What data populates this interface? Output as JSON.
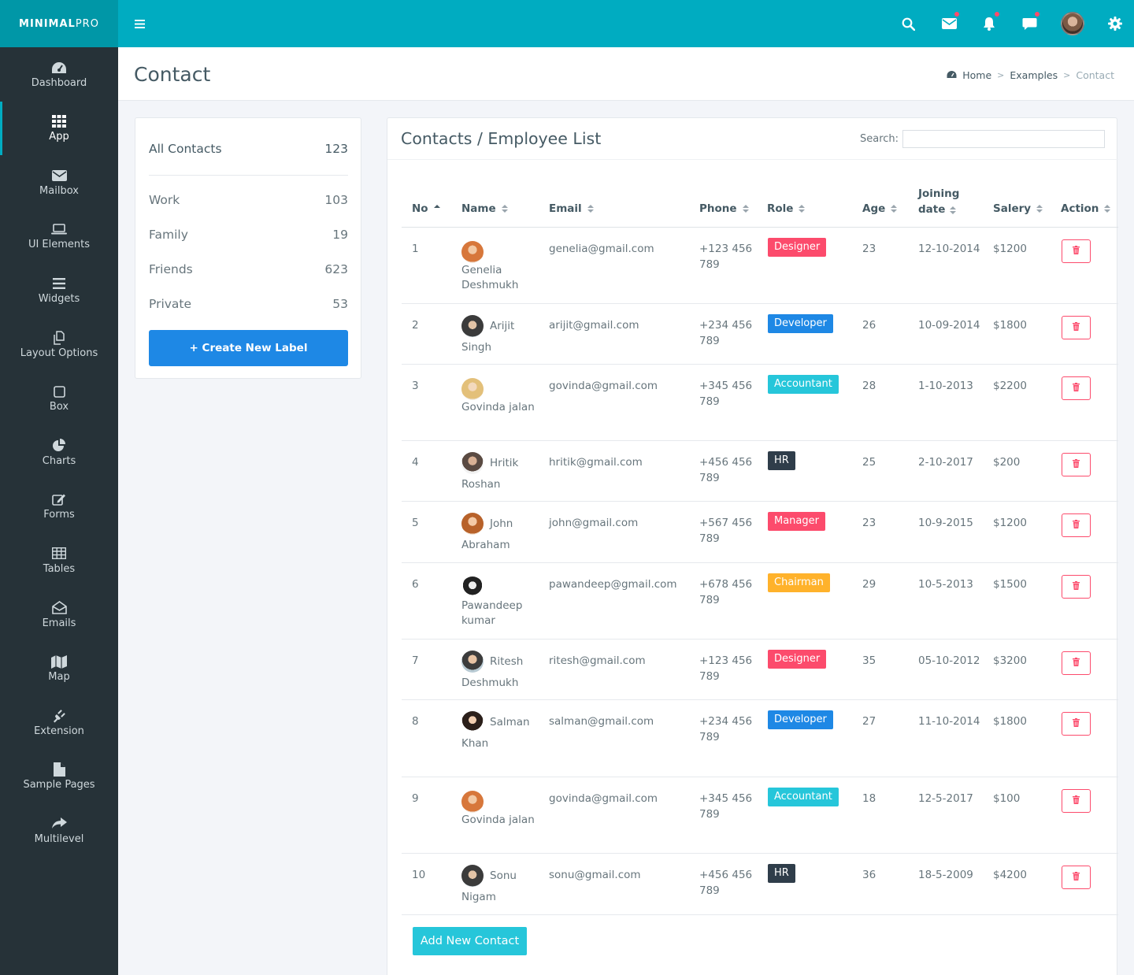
{
  "brand": {
    "bold": "MINIMAL",
    "light": "PRO"
  },
  "colors": {
    "topbar": "#00acc1",
    "sidebar": "#263238",
    "primary": "#1e88e5",
    "danger": "#fc4b6c",
    "info": "#26c6da",
    "warning": "#ffb22b",
    "dark": "#2f3d4a"
  },
  "topbar_icons": [
    "menu-icon",
    "search-icon",
    "envelope-icon",
    "bell-icon",
    "comment-icon",
    "settings-icon"
  ],
  "sidebar": {
    "items": [
      {
        "label": "Dashboard",
        "icon": "dashboard-icon"
      },
      {
        "label": "App",
        "icon": "grid-icon",
        "active": true
      },
      {
        "label": "Mailbox",
        "icon": "envelope-icon"
      },
      {
        "label": "UI Elements",
        "icon": "laptop-icon"
      },
      {
        "label": "Widgets",
        "icon": "bars-icon"
      },
      {
        "label": "Layout Options",
        "icon": "copy-icon"
      },
      {
        "label": "Box",
        "icon": "square-icon"
      },
      {
        "label": "Charts",
        "icon": "pie-chart-icon"
      },
      {
        "label": "Forms",
        "icon": "edit-icon"
      },
      {
        "label": "Tables",
        "icon": "table-icon"
      },
      {
        "label": "Emails",
        "icon": "envelope-open-icon"
      },
      {
        "label": "Map",
        "icon": "map-icon"
      },
      {
        "label": "Extension",
        "icon": "plug-icon"
      },
      {
        "label": "Sample Pages",
        "icon": "file-icon"
      },
      {
        "label": "Multilevel",
        "icon": "share-icon"
      }
    ]
  },
  "page": {
    "title": "Contact"
  },
  "breadcrumb": {
    "home": "Home",
    "examples": "Examples",
    "current": "Contact"
  },
  "labels": {
    "items": [
      {
        "label": "All Contacts",
        "count": "123"
      },
      {
        "label": "Work",
        "count": "103"
      },
      {
        "label": "Family",
        "count": "19"
      },
      {
        "label": "Friends",
        "count": "623"
      },
      {
        "label": "Private",
        "count": "53"
      }
    ],
    "create_button": "+ Create New Label"
  },
  "contacts": {
    "title": "Contacts / Employee List",
    "search_label": "Search:",
    "search_value": "",
    "columns": [
      "No",
      "Name",
      "Email",
      "Phone",
      "Role",
      "Age",
      "Joining date",
      "Salery",
      "Action"
    ],
    "rows": [
      {
        "no": "1",
        "name": "Genelia Deshmukh",
        "email": "genelia@gmail.com",
        "phone": "+123 456 789",
        "role": "Designer",
        "age": "23",
        "join": "12-10-2014",
        "salary": "$1200"
      },
      {
        "no": "2",
        "name": "Arijit Singh",
        "email": "arijit@gmail.com",
        "phone": "+234 456 789",
        "role": "Developer",
        "age": "26",
        "join": "10-09-2014",
        "salary": "$1800"
      },
      {
        "no": "3",
        "name": "Govinda jalan",
        "email": "govinda@gmail.com",
        "phone": "+345 456 789",
        "role": "Accountant",
        "age": "28",
        "join": "1-10-2013",
        "salary": "$2200"
      },
      {
        "no": "4",
        "name": "Hritik Roshan",
        "email": "hritik@gmail.com",
        "phone": "+456 456 789",
        "role": "HR",
        "age": "25",
        "join": "2-10-2017",
        "salary": "$200"
      },
      {
        "no": "5",
        "name": "John Abraham",
        "email": "john@gmail.com",
        "phone": "+567 456 789",
        "role": "Manager",
        "age": "23",
        "join": "10-9-2015",
        "salary": "$1200"
      },
      {
        "no": "6",
        "name": "Pawandeep kumar",
        "email": "pawandeep@gmail.com",
        "phone": "+678 456 789",
        "role": "Chairman",
        "age": "29",
        "join": "10-5-2013",
        "salary": "$1500"
      },
      {
        "no": "7",
        "name": "Ritesh Deshmukh",
        "email": "ritesh@gmail.com",
        "phone": "+123 456 789",
        "role": "Designer",
        "age": "35",
        "join": "05-10-2012",
        "salary": "$3200"
      },
      {
        "no": "8",
        "name": "Salman Khan",
        "email": "salman@gmail.com",
        "phone": "+234 456 789",
        "role": "Developer",
        "age": "27",
        "join": "11-10-2014",
        "salary": "$1800"
      },
      {
        "no": "9",
        "name": "Govinda jalan",
        "email": "govinda@gmail.com",
        "phone": "+345 456 789",
        "role": "Accountant",
        "age": "18",
        "join": "12-5-2017",
        "salary": "$100"
      },
      {
        "no": "10",
        "name": "Sonu Nigam",
        "email": "sonu@gmail.com",
        "phone": "+456 456 789",
        "role": "HR",
        "age": "36",
        "join": "18-5-2009",
        "salary": "$4200"
      }
    ],
    "add_button": "Add New Contact"
  }
}
